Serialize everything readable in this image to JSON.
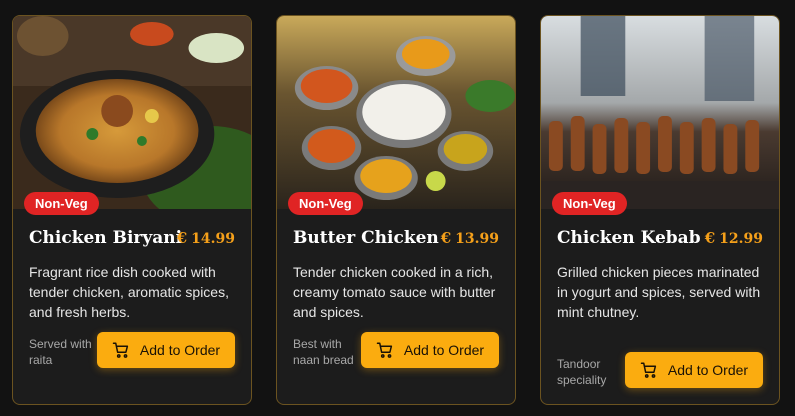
{
  "cards": [
    {
      "badge": "Non-Veg",
      "title": "Chicken Biryani",
      "currency": "€",
      "price": "14.99",
      "description": "Fragrant rice dish cooked with tender chicken, aromatic spices, and fresh herbs.",
      "note": "Served with raita",
      "button_label": "Add to Order",
      "image_icon": "biryani-dish-image"
    },
    {
      "badge": "Non-Veg",
      "title": "Butter Chicken",
      "currency": "€",
      "price": "13.99",
      "description": "Tender chicken cooked in a rich, creamy tomato sauce with butter and spices.",
      "note": "Best with naan bread",
      "button_label": "Add to Order",
      "image_icon": "curry-spread-image"
    },
    {
      "badge": "Non-Veg",
      "title": "Chicken Kebab",
      "currency": "€",
      "price": "12.99",
      "description": "Grilled chicken pieces marinated in yogurt and spices, served with mint chutney.",
      "note": "Tandoor speciality",
      "button_label": "Add to Order",
      "image_icon": "kebab-grill-image"
    }
  ],
  "colors": {
    "background": "#121212",
    "card": "#1c1c1c",
    "accent": "#fbac0f",
    "price": "#f5a01a",
    "badge": "#e02424"
  }
}
